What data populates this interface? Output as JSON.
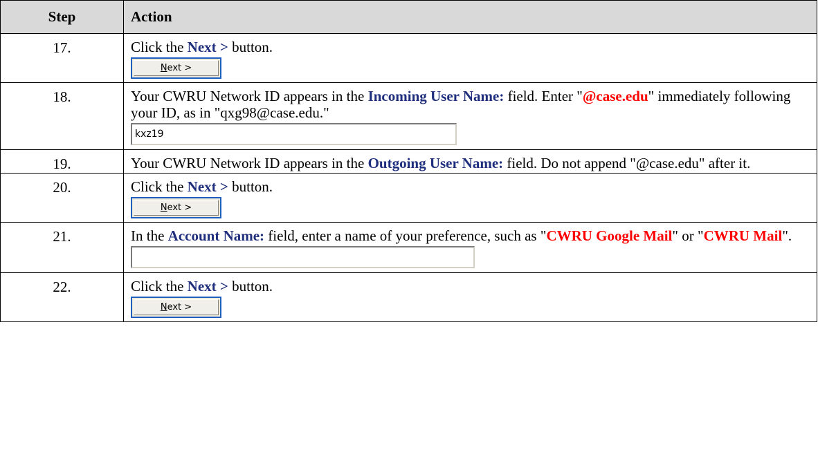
{
  "table": {
    "header": {
      "step": "Step",
      "action": "Action"
    },
    "rows": [
      {
        "step": "17.",
        "text": [
          {
            "t": "Click the "
          },
          {
            "t": "Next >",
            "s": "blue"
          },
          {
            "t": " button."
          }
        ],
        "widget": {
          "kind": "button",
          "mnemonic": "N",
          "rest": "ext >"
        }
      },
      {
        "step": "18.",
        "text": [
          {
            "t": "Your CWRU Network ID appears in the "
          },
          {
            "t": "Incoming User Name:",
            "s": "blue"
          },
          {
            "t": " field. Enter \""
          },
          {
            "t": "@case.edu",
            "s": "red"
          },
          {
            "t": "\" immediately following your ID, as in \"qxg98@case.edu.\""
          }
        ],
        "widget": {
          "kind": "input",
          "value": "kxz19",
          "size": "short"
        }
      },
      {
        "step": "19.",
        "text": [
          {
            "t": "Your CWRU Network ID appears in the "
          },
          {
            "t": "Outgoing User Name:",
            "s": "blue"
          },
          {
            "t": " field. Do not append \"@case.edu\" after it."
          }
        ]
      },
      {
        "step": "20.",
        "text": [
          {
            "t": "Click the "
          },
          {
            "t": "Next >",
            "s": "blue"
          },
          {
            "t": " button."
          }
        ],
        "widget": {
          "kind": "button",
          "mnemonic": "N",
          "rest": "ext >"
        }
      },
      {
        "step": "21.",
        "text": [
          {
            "t": "In the "
          },
          {
            "t": "Account Name:",
            "s": "blue"
          },
          {
            "t": " field, enter a name of your preference, such as \""
          },
          {
            "t": "CWRU Google Mail",
            "s": "red"
          },
          {
            "t": "\" or \""
          },
          {
            "t": "CWRU Mail",
            "s": "red"
          },
          {
            "t": "\"."
          }
        ],
        "widget": {
          "kind": "input",
          "value": "",
          "size": "long"
        }
      },
      {
        "step": "22.",
        "text": [
          {
            "t": "Click the "
          },
          {
            "t": "Next >",
            "s": "blue"
          },
          {
            "t": " button."
          }
        ],
        "widget": {
          "kind": "button",
          "mnemonic": "N",
          "rest": "ext >"
        }
      }
    ]
  },
  "colors": {
    "keyword_blue": "#1f2f7d",
    "keyword_red": "#ff0000",
    "header_bg": "#d9d9d9"
  }
}
